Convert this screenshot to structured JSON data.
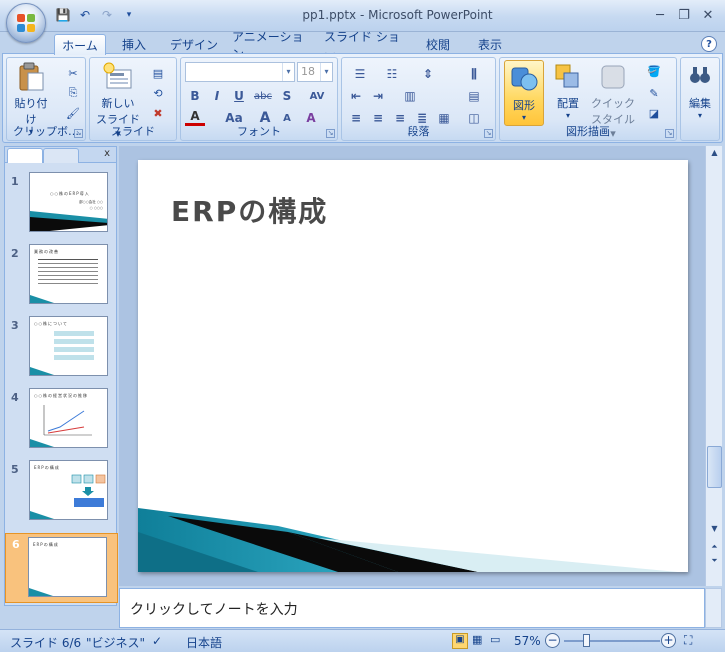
{
  "window": {
    "title": "pp1.pptx - Microsoft PowerPoint",
    "minimize": "─",
    "restore": "❐",
    "close": "✕"
  },
  "qat": {
    "save": "💾",
    "undo": "↶",
    "redo": "↷",
    "customize": "▾"
  },
  "tabs": [
    "ホーム",
    "挿入",
    "デザイン",
    "アニメーション",
    "スライド ショー",
    "校閲",
    "表示"
  ],
  "help": "?",
  "ribbon": {
    "clipboard": {
      "label": "クリップボ…",
      "paste": "貼り付け",
      "cut": "✂",
      "copy": "⎘",
      "format_painter": "🖌"
    },
    "slides": {
      "label": "スライド",
      "new_slide_line1": "新しい",
      "new_slide_line2": "スライド ▾"
    },
    "font": {
      "label": "フォント",
      "font_name": "",
      "font_size": "18",
      "bold": "B",
      "italic": "I",
      "underline": "U",
      "strike": "abc",
      "shadow": "S",
      "spacing": "AV",
      "color": "A",
      "case": "Aa",
      "grow": "A",
      "shrink": "A",
      "clear": "A"
    },
    "paragraph": {
      "label": "段落"
    },
    "drawing": {
      "label": "図形描画",
      "shapes": "図形",
      "arrange": "配置",
      "quick_styles_line1": "クイック",
      "quick_styles_line2": "スタイル ▾"
    },
    "editing": {
      "label": "編集"
    }
  },
  "pane": {
    "close": "x"
  },
  "thumbnails": [
    {
      "num": "1",
      "title": "○○株のERP導入",
      "sub1": "部○○会社 ○○",
      "sub2": "○ ○○○"
    },
    {
      "num": "2",
      "title": "業務の改善",
      "sub1": "",
      "sub2": ""
    },
    {
      "num": "3",
      "title": "○○株について",
      "sub1": "",
      "sub2": ""
    },
    {
      "num": "4",
      "title": "○○株の経営状況の推移",
      "sub1": "",
      "sub2": ""
    },
    {
      "num": "5",
      "title": "ERPの構成",
      "sub1": "",
      "sub2": ""
    },
    {
      "num": "6",
      "title": "ERPの構成",
      "sub1": "",
      "sub2": ""
    }
  ],
  "slide": {
    "title": "ERPの構成"
  },
  "notes": {
    "placeholder": "クリックしてノートを入力"
  },
  "status": {
    "slide": "スライド 6/6",
    "theme": "\"ビジネス\"",
    "language": "日本語",
    "zoom": "57%",
    "zoom_minus": "−",
    "zoom_plus": "+"
  },
  "colors": {
    "accent": "#1a8fa6",
    "ribbon": "#d6e4f5",
    "status_bg": "#bcd2ee"
  }
}
